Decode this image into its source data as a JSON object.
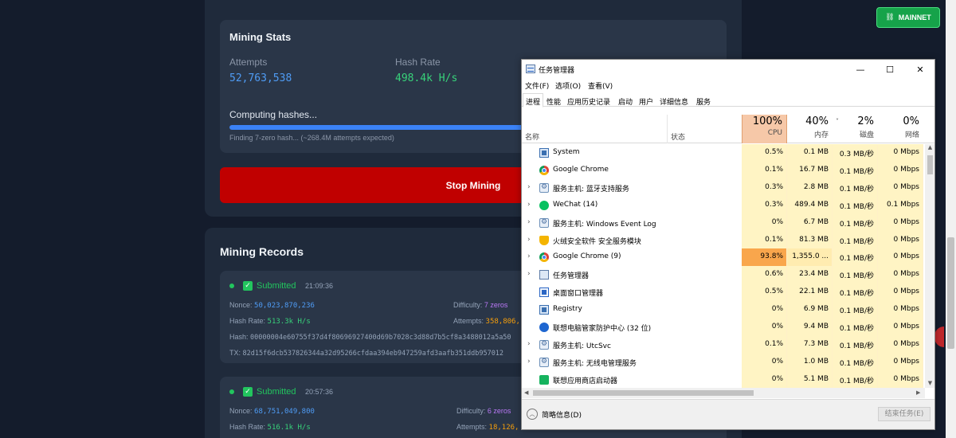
{
  "mining": {
    "stats_title": "Mining Stats",
    "attempts_label": "Attempts",
    "attempts_value": "52,763,538",
    "hash_rate_label": "Hash Rate",
    "hash_rate_value": "498.4k H/s",
    "computing_label": "Computing hashes...",
    "progress_fraction": 0.64,
    "finding_text": "Finding 7-zero hash... (~268.4M attempts expected)",
    "stop_button": "Stop Mining",
    "records_title": "Mining Records",
    "records": [
      {
        "status": "Submitted",
        "time": "21:09:36",
        "nonce_label": "Nonce:",
        "nonce": "50,023,870,236",
        "difficulty_label": "Difficulty:",
        "difficulty": "7 zeros",
        "hash_rate_label": "Hash Rate:",
        "hash_rate": "513.3k H/s",
        "attempts_label": "Attempts:",
        "attempts": "358,806,",
        "hash_label": "Hash:",
        "hash": "00000004e60755f37d4f80696927400d69b7028c3d88d7b5cf8a3488012a5a50",
        "tx_label": "TX:",
        "tx": "82d15f6dcb537826344a32d95266cfdaa394eb947259afd3aafb351ddb957012"
      },
      {
        "status": "Submitted",
        "time": "20:57:36",
        "nonce_label": "Nonce:",
        "nonce": "68,751,049,800",
        "difficulty_label": "Difficulty:",
        "difficulty": "6 zeros",
        "hash_rate_label": "Hash Rate:",
        "hash_rate": "516.1k H/s",
        "attempts_label": "Attempts:",
        "attempts": "18,126,"
      }
    ]
  },
  "network_badge": {
    "label": "MAINNET",
    "icon": "link-icon"
  },
  "task_manager": {
    "title": "任务管理器",
    "menus": [
      "文件(F)",
      "选项(O)",
      "查看(V)"
    ],
    "tabs": [
      "进程",
      "性能",
      "应用历史记录",
      "启动",
      "用户",
      "详细信息",
      "服务"
    ],
    "active_tab": "进程",
    "columns": {
      "name": "名称",
      "status": "状态",
      "cpu_pct": "100%",
      "cpu": "CPU",
      "mem_pct": "40%",
      "mem": "内存",
      "disk_pct": "2%",
      "disk": "磁盘",
      "net_pct": "0%",
      "net": "网络"
    },
    "processes": [
      {
        "name": "System",
        "expand": "",
        "icon": "system-icon",
        "cpu": "0.5%",
        "mem": "0.1 MB",
        "disk": "0.3 MB/秒",
        "net": "0 Mbps"
      },
      {
        "name": "Google Chrome",
        "expand": "",
        "icon": "chrome-icon",
        "cpu": "0.1%",
        "mem": "16.7 MB",
        "disk": "0.1 MB/秒",
        "net": "0 Mbps"
      },
      {
        "name": "服务主机: 蓝牙支持服务",
        "expand": "›",
        "icon": "gear-icon",
        "cpu": "0.3%",
        "mem": "2.8 MB",
        "disk": "0.1 MB/秒",
        "net": "0 Mbps"
      },
      {
        "name": "WeChat (14)",
        "expand": "›",
        "icon": "wechat-icon",
        "cpu": "0.3%",
        "mem": "489.4 MB",
        "disk": "0.1 MB/秒",
        "net": "0.1 Mbps"
      },
      {
        "name": "服务主机: Windows Event Log",
        "expand": "›",
        "icon": "gear-icon",
        "cpu": "0%",
        "mem": "6.7 MB",
        "disk": "0.1 MB/秒",
        "net": "0 Mbps"
      },
      {
        "name": "火绒安全软件 安全服务模块",
        "expand": "›",
        "icon": "shield-icon",
        "cpu": "0.1%",
        "mem": "81.3 MB",
        "disk": "0.1 MB/秒",
        "net": "0 Mbps"
      },
      {
        "name": "Google Chrome (9)",
        "expand": "›",
        "icon": "chrome-icon",
        "cpu": "93.8%",
        "mem": "1,355.0 ...",
        "disk": "0.1 MB/秒",
        "net": "0 Mbps",
        "hot": true
      },
      {
        "name": "任务管理器",
        "expand": "›",
        "icon": "task-manager-icon",
        "cpu": "0.6%",
        "mem": "23.4 MB",
        "disk": "0.1 MB/秒",
        "net": "0 Mbps"
      },
      {
        "name": "桌面窗口管理器",
        "expand": "",
        "icon": "desktop-window-icon",
        "cpu": "0.5%",
        "mem": "22.1 MB",
        "disk": "0.1 MB/秒",
        "net": "0 Mbps"
      },
      {
        "name": "Registry",
        "expand": "",
        "icon": "system-icon",
        "cpu": "0%",
        "mem": "6.9 MB",
        "disk": "0.1 MB/秒",
        "net": "0 Mbps"
      },
      {
        "name": "联想电脑管家防护中心 (32 位)",
        "expand": "",
        "icon": "lenovo-icon",
        "cpu": "0%",
        "mem": "9.4 MB",
        "disk": "0.1 MB/秒",
        "net": "0 Mbps"
      },
      {
        "name": "服务主机: UtcSvc",
        "expand": "›",
        "icon": "gear-icon",
        "cpu": "0.1%",
        "mem": "7.3 MB",
        "disk": "0.1 MB/秒",
        "net": "0 Mbps"
      },
      {
        "name": "服务主机: 无线电管理服务",
        "expand": "›",
        "icon": "gear-icon",
        "cpu": "0%",
        "mem": "1.0 MB",
        "disk": "0.1 MB/秒",
        "net": "0 Mbps"
      },
      {
        "name": "联想应用商店启动器",
        "expand": "",
        "icon": "store-icon",
        "cpu": "0%",
        "mem": "5.1 MB",
        "disk": "0.1 MB/秒",
        "net": "0 Mbps"
      }
    ],
    "fewer_details": "简略信息(D)",
    "end_task": "结束任务(E)"
  }
}
